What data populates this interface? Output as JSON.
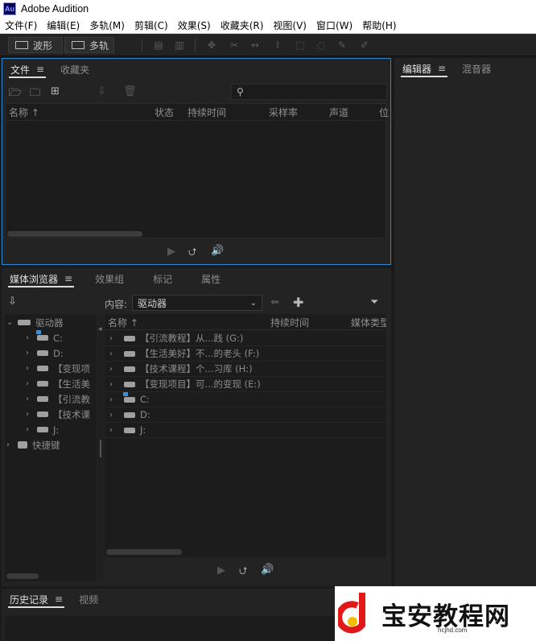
{
  "app": {
    "logo": "Au",
    "title": "Adobe Audition"
  },
  "menu": [
    "文件(F)",
    "编辑(E)",
    "多轨(M)",
    "剪辑(C)",
    "效果(S)",
    "收藏夹(R)",
    "视图(V)",
    "窗口(W)",
    "帮助(H)"
  ],
  "toolbar": {
    "waveform_label": "波形",
    "multitrack_label": "多轨"
  },
  "files_panel": {
    "tabs": [
      "文件",
      "收藏夹"
    ],
    "menu_glyph": "≡",
    "search_placeholder": "",
    "columns": [
      "名称 ↑",
      "状态",
      "持续时间",
      "采样率",
      "声道",
      "位"
    ]
  },
  "editor_panel": {
    "tabs": [
      "编辑器",
      "混音器"
    ],
    "menu_glyph": "≡"
  },
  "media_panel": {
    "tabs": [
      "媒体浏览器",
      "效果组",
      "标记",
      "属性"
    ],
    "menu_glyph": "≡",
    "content_label": "内容:",
    "content_value": "驱动器",
    "tree": [
      {
        "label": "驱动器",
        "expanded": true,
        "level": 0,
        "icon": "drives-icon"
      },
      {
        "label": "C:",
        "level": 1,
        "icon": "windows-drive-icon"
      },
      {
        "label": "D:",
        "level": 1,
        "icon": "drive-icon"
      },
      {
        "label": "【变现项",
        "level": 1,
        "icon": "drive-icon"
      },
      {
        "label": "【生活美",
        "level": 1,
        "icon": "drive-icon"
      },
      {
        "label": "【引流教",
        "level": 1,
        "icon": "drive-icon"
      },
      {
        "label": "【技术课",
        "level": 1,
        "icon": "drive-icon"
      },
      {
        "label": "J:",
        "level": 1,
        "icon": "drive-icon"
      },
      {
        "label": "快捷键",
        "level": 0,
        "icon": "shortcut-icon"
      }
    ],
    "list_columns": [
      "名称 ↑",
      "持续时间",
      "媒体类型"
    ],
    "list_rows": [
      {
        "label": "【引流教程】从...践 (G:)",
        "icon": "drive-icon"
      },
      {
        "label": "【生活美好】不...的老头 (F:)",
        "icon": "drive-icon"
      },
      {
        "label": "【技术课程】个...习库 (H:)",
        "icon": "drive-icon"
      },
      {
        "label": "【变现项目】可...的变现 (E:)",
        "icon": "drive-icon"
      },
      {
        "label": "C:",
        "icon": "windows-drive-icon"
      },
      {
        "label": "D:",
        "icon": "drive-icon"
      },
      {
        "label": "J:",
        "icon": "drive-icon"
      }
    ]
  },
  "history_panel": {
    "tabs": [
      "历史记录",
      "视频"
    ],
    "menu_glyph": "≡"
  },
  "watermark": {
    "text": "宝安教程网",
    "url": "hcjhd.com"
  },
  "colors": {
    "accent": "#2f86d0",
    "panel_bg": "#232323",
    "app_bg": "#1a1a1a",
    "list_bg": "#1c1c1c"
  }
}
